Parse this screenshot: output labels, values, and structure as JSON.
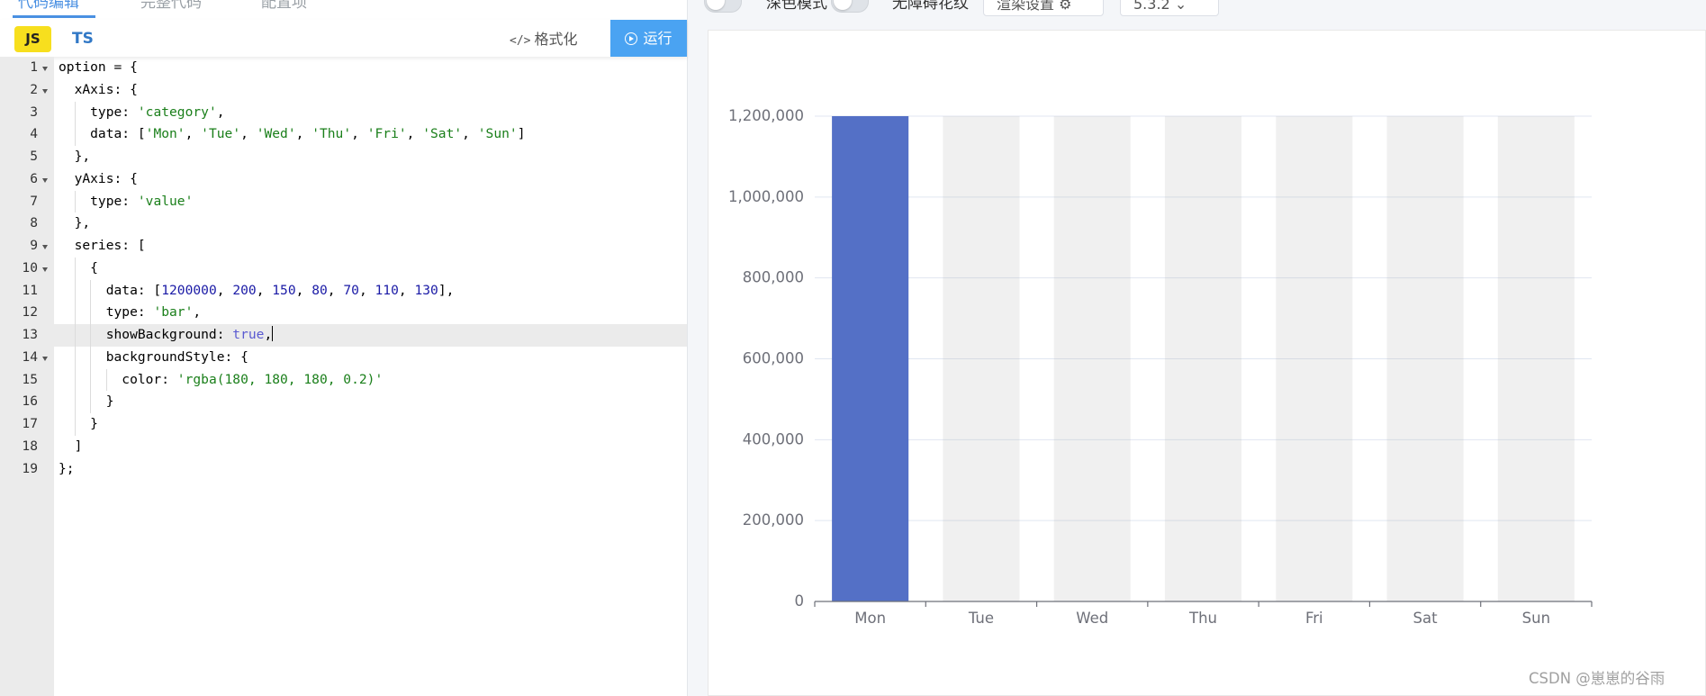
{
  "top_tabs": [
    "代码编辑",
    "完整代码",
    "配置项"
  ],
  "toolbar": {
    "lang_js": "JS",
    "lang_ts": "TS",
    "format_label": "格式化",
    "run_label": "运行"
  },
  "settings": {
    "dark_mode_label": "深色模式",
    "accessible_label": "无障碍花纹",
    "render_settings_label": "渲染设置",
    "version": "5.3.2"
  },
  "editor": {
    "active_line": 13,
    "lines": [
      "option = {",
      "  xAxis: {",
      "    type: 'category',",
      "    data: ['Mon', 'Tue', 'Wed', 'Thu', 'Fri', 'Sat', 'Sun']",
      "  },",
      "  yAxis: {",
      "    type: 'value'",
      "  },",
      "  series: [",
      "    {",
      "      data: [1200000, 200, 150, 80, 70, 110, 130],",
      "      type: 'bar',",
      "      showBackground: true,",
      "      backgroundStyle: {",
      "        color: 'rgba(180, 180, 180, 0.2)'",
      "      }",
      "    }",
      "  ]",
      "};"
    ],
    "fold_lines": [
      1,
      2,
      6,
      9,
      10,
      14
    ]
  },
  "chart_data": {
    "type": "bar",
    "categories": [
      "Mon",
      "Tue",
      "Wed",
      "Thu",
      "Fri",
      "Sat",
      "Sun"
    ],
    "values": [
      1200000,
      200,
      150,
      80,
      70,
      110,
      130
    ],
    "ylim": [
      0,
      1200000
    ],
    "yticks": [
      "0",
      "200,000",
      "400,000",
      "600,000",
      "800,000",
      "1,000,000",
      "1,200,000"
    ],
    "title": "",
    "xlabel": "",
    "ylabel": "",
    "grid": true,
    "show_background": true,
    "bar_color": "#5470c6",
    "background_color": "rgba(180, 180, 180, 0.2)"
  },
  "watermark": "CSDN @崽崽的谷雨"
}
